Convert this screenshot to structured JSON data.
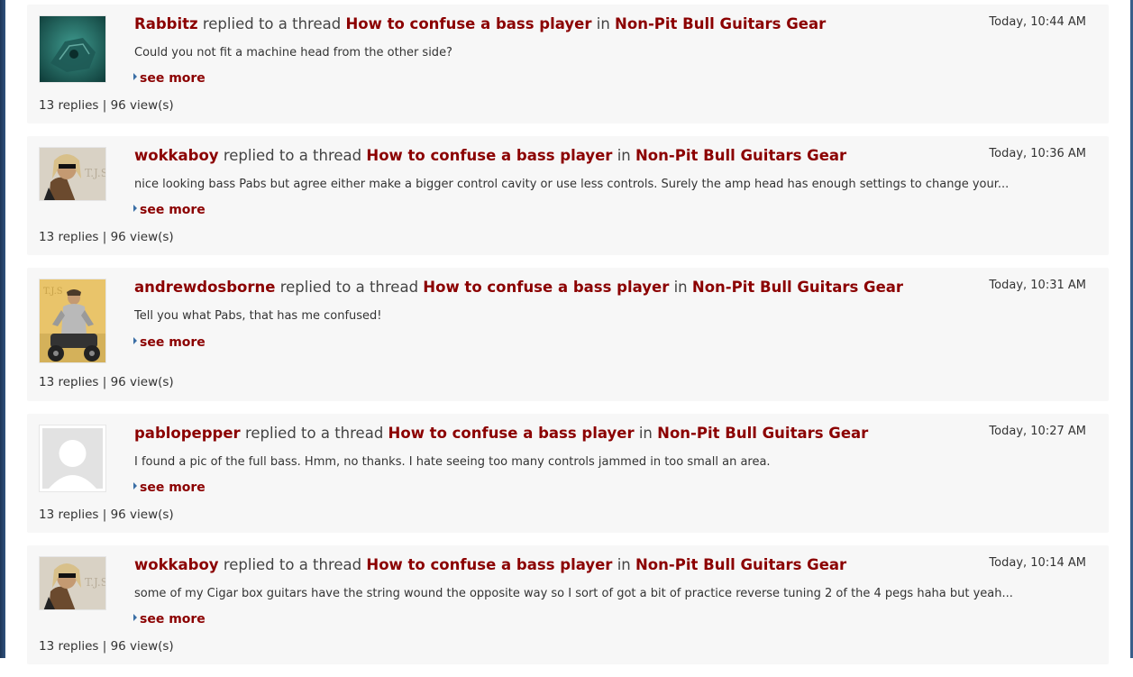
{
  "colors": {
    "link": "#8b0000",
    "card_bg": "#f7f7f7",
    "bullet": "#3a6ea5"
  },
  "activity": [
    {
      "user": "Rabbitz",
      "verb": "replied to a thread",
      "thread": "How to confuse a bass player",
      "in": "in",
      "forum": "Non-Pit Bull Guitars Gear",
      "time": "Today, 10:44 AM",
      "snippet": "Could you not fit a machine head from the other side?",
      "see_more": "see more",
      "stats": "13 replies | 96 view(s)",
      "avatar_icon": "underwater-wreck-avatar"
    },
    {
      "user": "wokkaboy",
      "verb": "replied to a thread",
      "thread": "How to confuse a bass player",
      "in": "in",
      "forum": "Non-Pit Bull Guitars Gear",
      "time": "Today, 10:36 AM",
      "snippet": "nice looking bass Pabs but agree either make a bigger control cavity or use less controls. Surely the amp head has enough settings to change your...",
      "see_more": "see more",
      "stats": "13 replies | 96 view(s)",
      "avatar_icon": "man-with-sunglasses-avatar"
    },
    {
      "user": "andrewdosborne",
      "verb": "replied to a thread",
      "thread": "How to confuse a bass player",
      "in": "in",
      "forum": "Non-Pit Bull Guitars Gear",
      "time": "Today, 10:31 AM",
      "snippet": "Tell you what Pabs, that has me confused!",
      "see_more": "see more",
      "stats": "13 replies | 96 view(s)",
      "avatar_icon": "man-on-motorbike-avatar"
    },
    {
      "user": "pablopepper",
      "verb": "replied to a thread",
      "thread": "How to confuse a bass player",
      "in": "in",
      "forum": "Non-Pit Bull Guitars Gear",
      "time": "Today, 10:27 AM",
      "snippet": "I found a pic of the full bass. Hmm, no thanks. I hate seeing too many controls jammed in too small an area.",
      "see_more": "see more",
      "stats": "13 replies | 96 view(s)",
      "avatar_icon": "default-user-avatar"
    },
    {
      "user": "wokkaboy",
      "verb": "replied to a thread",
      "thread": "How to confuse a bass player",
      "in": "in",
      "forum": "Non-Pit Bull Guitars Gear",
      "time": "Today, 10:14 AM",
      "snippet": "some of my Cigar box guitars have the string wound the opposite way so I sort of got a bit of practice reverse tuning 2 of the 4 pegs haha but yeah...",
      "see_more": "see more",
      "stats": "13 replies | 96 view(s)",
      "avatar_icon": "man-with-sunglasses-avatar"
    }
  ]
}
